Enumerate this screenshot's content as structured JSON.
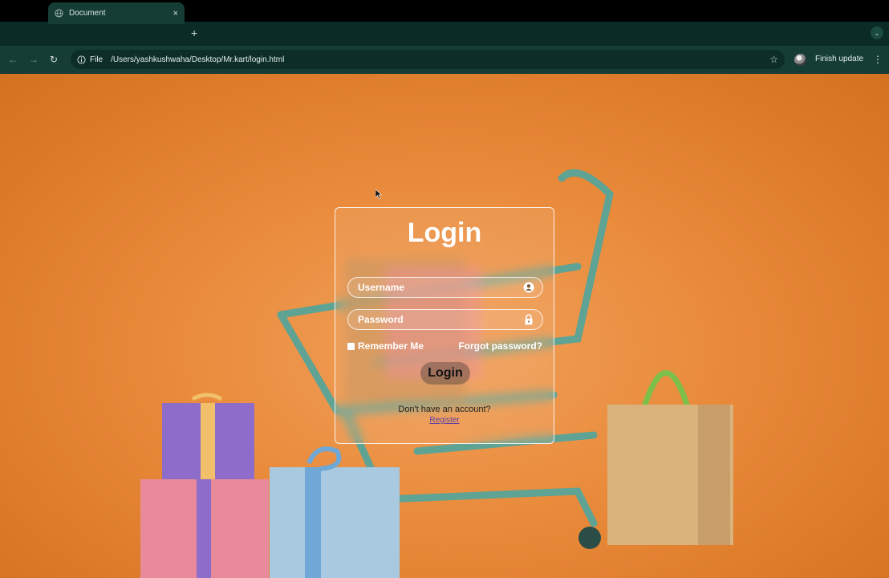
{
  "browser": {
    "tab_title": "Document",
    "tab_close": "×",
    "new_tab": "+",
    "url_scheme": "File",
    "url": "/Users/yashkushwaha/Desktop/Mr.kart/login.html",
    "finish_update": "Finish update"
  },
  "login": {
    "title": "Login",
    "username_placeholder": "Username",
    "password_placeholder": "Password",
    "remember_me": "Remember Me",
    "forgot_password": "Forgot password?",
    "login_button": "Login",
    "no_account": "Don't have an account?",
    "register": "Register"
  },
  "colors": {
    "page_background": "#e98a3a",
    "chrome_dark": "#0a2b26",
    "chrome_toolbar": "#153d36"
  },
  "icons": {
    "username": "user-icon",
    "password": "lock-icon"
  }
}
